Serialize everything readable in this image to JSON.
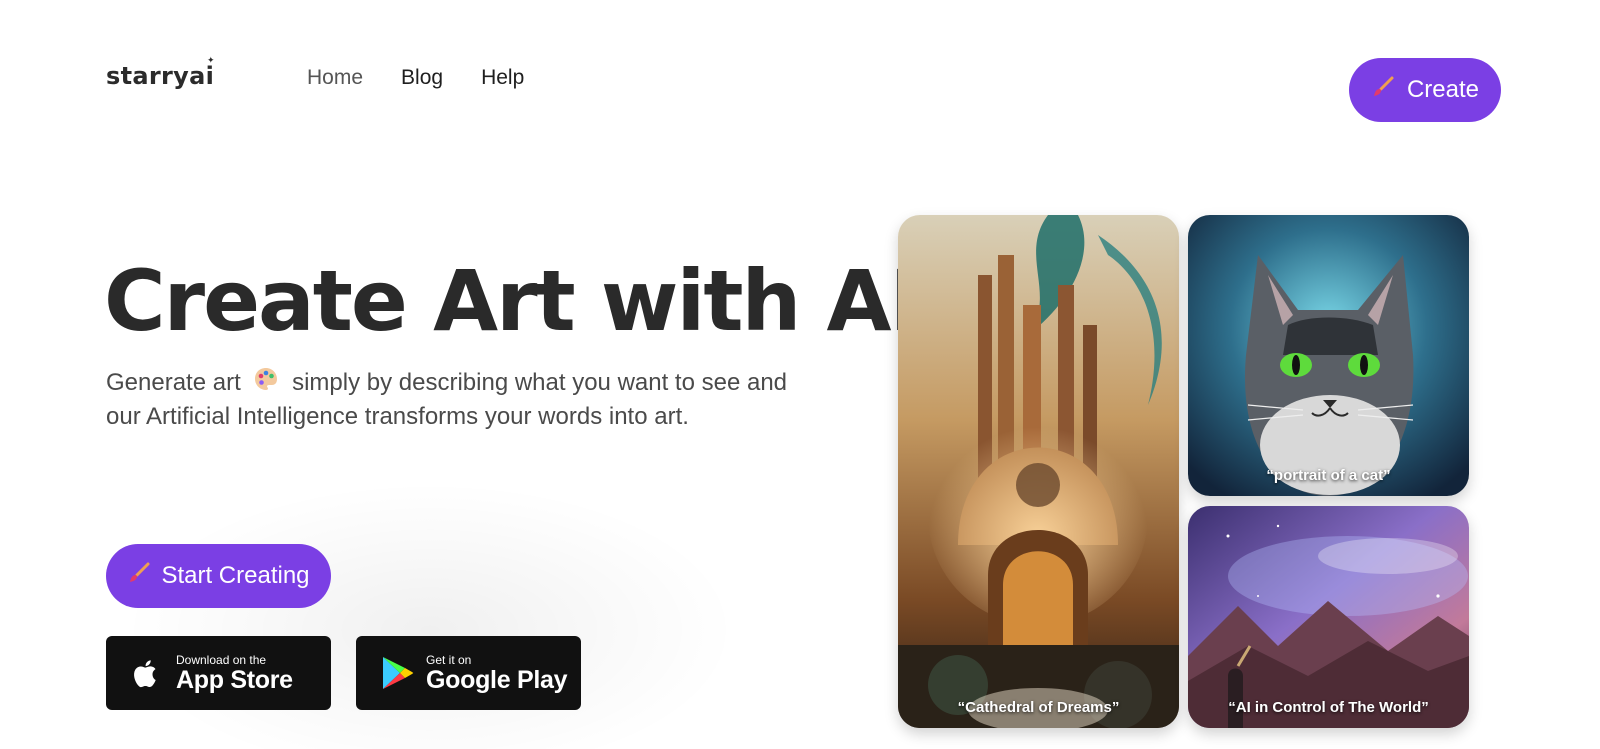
{
  "header": {
    "logo_text": "starryai",
    "nav": [
      {
        "label": "Home"
      },
      {
        "label": "Blog"
      },
      {
        "label": "Help"
      }
    ],
    "create_label": "Create"
  },
  "hero": {
    "title": "Create Art with AI",
    "subtitle_part1": "Generate art",
    "subtitle_part2": "simply by describing what you want to see and our Artificial Intelligence transforms your words into art.",
    "start_label": "Start Creating"
  },
  "stores": {
    "apple_small": "Download on the",
    "apple_big": "App Store",
    "google_small": "Get it on",
    "google_big": "Google Play"
  },
  "gallery": [
    {
      "caption": "“Cathedral of Dreams”"
    },
    {
      "caption": "“portrait of a cat”"
    },
    {
      "caption": "“AI in Control of The World”"
    }
  ],
  "colors": {
    "accent": "#7b3fe4",
    "store_button": "#111111",
    "title_text": "#2a2a2a"
  },
  "icons": [
    "paintbrush-icon",
    "palette-icon",
    "apple-icon",
    "google-play-icon"
  ]
}
